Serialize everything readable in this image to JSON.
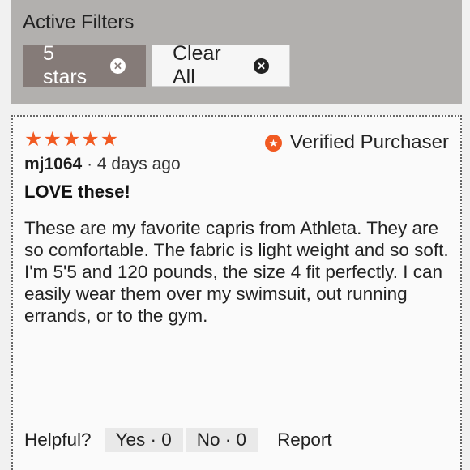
{
  "filters": {
    "title": "Active Filters",
    "chips": [
      {
        "label": "5 stars",
        "icon": "close-circle-icon"
      },
      {
        "label": "Clear All",
        "icon": "close-circle-icon"
      }
    ]
  },
  "review": {
    "rating": 5,
    "rating_max": 5,
    "star_glyph": "★",
    "star_color": "#f15a22",
    "verified_label": "Verified Purchaser",
    "verified_icon": "star-badge-icon",
    "username": "mj1064",
    "separator": " · ",
    "age": "4 days ago",
    "title": "LOVE these!",
    "body": "These are my favorite capris from Athleta. They are so comfortable. The fabric is light weight and so soft. I'm 5'5 and 120 pounds, the size 4 fit perfectly. I can easily wear them over my swimsuit, out running errands, or to the gym."
  },
  "footer": {
    "helpful_label": "Helpful?",
    "yes_label": "Yes · 0",
    "no_label": "No · 0",
    "report_label": "Report"
  },
  "colors": {
    "accent": "#f15a22",
    "filter_bar_bg": "#b2b0ae",
    "active_chip_bg": "#857b78"
  }
}
